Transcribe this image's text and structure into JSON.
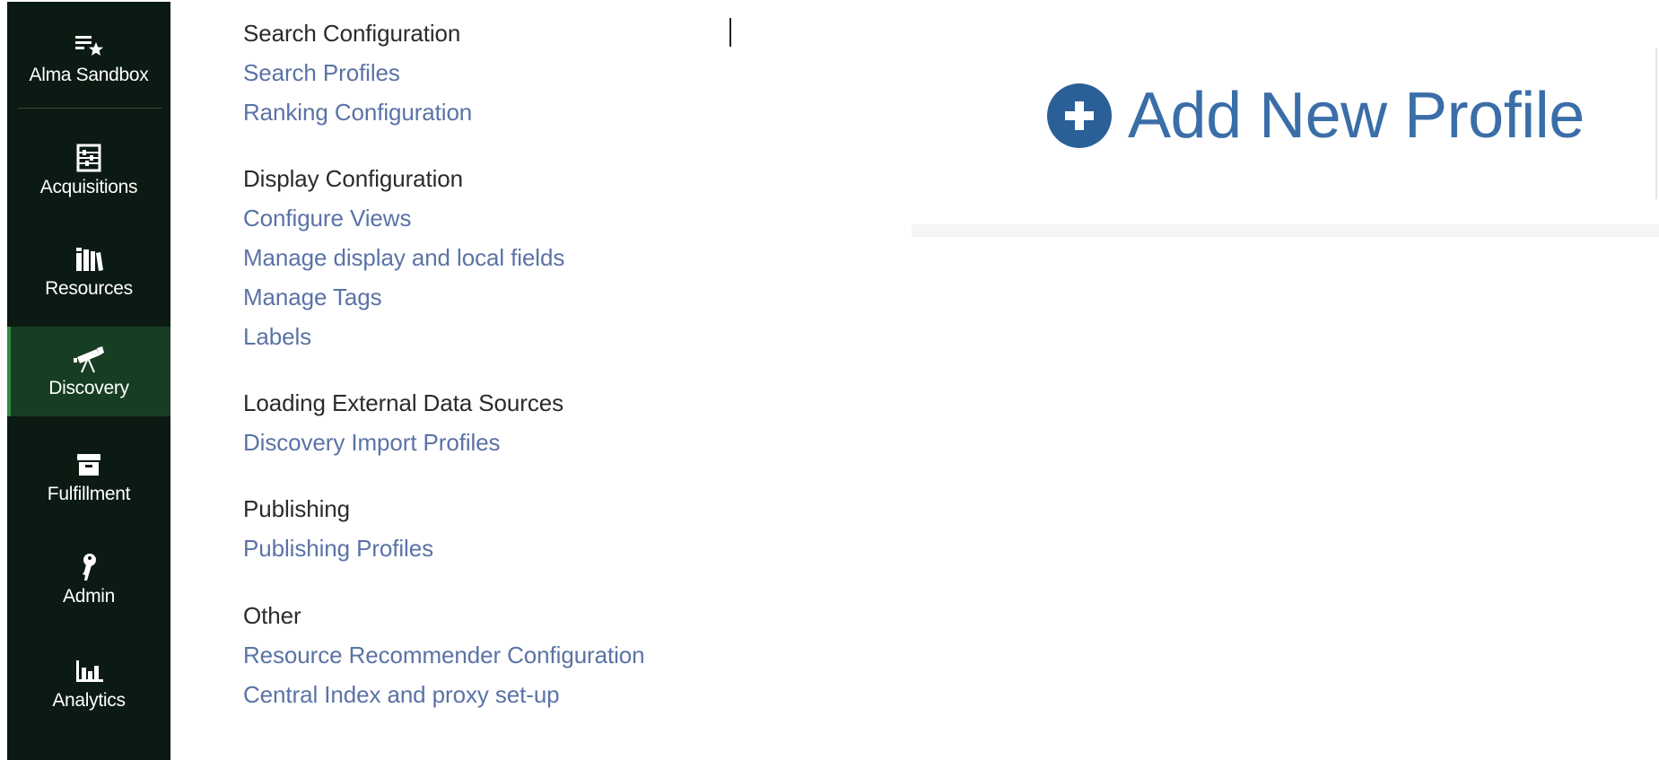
{
  "rail": {
    "items": [
      {
        "key": "sandbox",
        "label": "Alma Sandbox",
        "icon": "list-star-icon"
      },
      {
        "key": "acquisitions",
        "label": "Acquisitions",
        "icon": "abacus-icon"
      },
      {
        "key": "resources",
        "label": "Resources",
        "icon": "books-icon"
      },
      {
        "key": "discovery",
        "label": "Discovery",
        "icon": "telescope-icon",
        "active": true
      },
      {
        "key": "fulfillment",
        "label": "Fulfillment",
        "icon": "archive-box-icon"
      },
      {
        "key": "admin",
        "label": "Admin",
        "icon": "key-icon"
      },
      {
        "key": "analytics",
        "label": "Analytics",
        "icon": "bar-chart-icon"
      }
    ]
  },
  "menu": {
    "sections": [
      {
        "heading": "Search Configuration",
        "links": [
          "Search Profiles",
          "Ranking Configuration"
        ]
      },
      {
        "heading": "Display Configuration",
        "links": [
          "Configure Views",
          "Manage display and local fields",
          "Manage Tags",
          "Labels"
        ]
      },
      {
        "heading": "Loading External Data Sources",
        "links": [
          "Discovery Import Profiles"
        ]
      },
      {
        "heading": "Publishing",
        "links": [
          "Publishing Profiles"
        ]
      },
      {
        "heading": "Other",
        "links": [
          "Resource Recommender Configuration",
          "Central Index and proxy set-up"
        ]
      }
    ]
  },
  "action": {
    "add_profile_label": "Add New Profile"
  },
  "colors": {
    "rail_bg": "#0b1a12",
    "rail_active": "#173d22",
    "link": "#5a73a6",
    "heading": "#2b2b2b",
    "accent": "#2a5f98"
  }
}
